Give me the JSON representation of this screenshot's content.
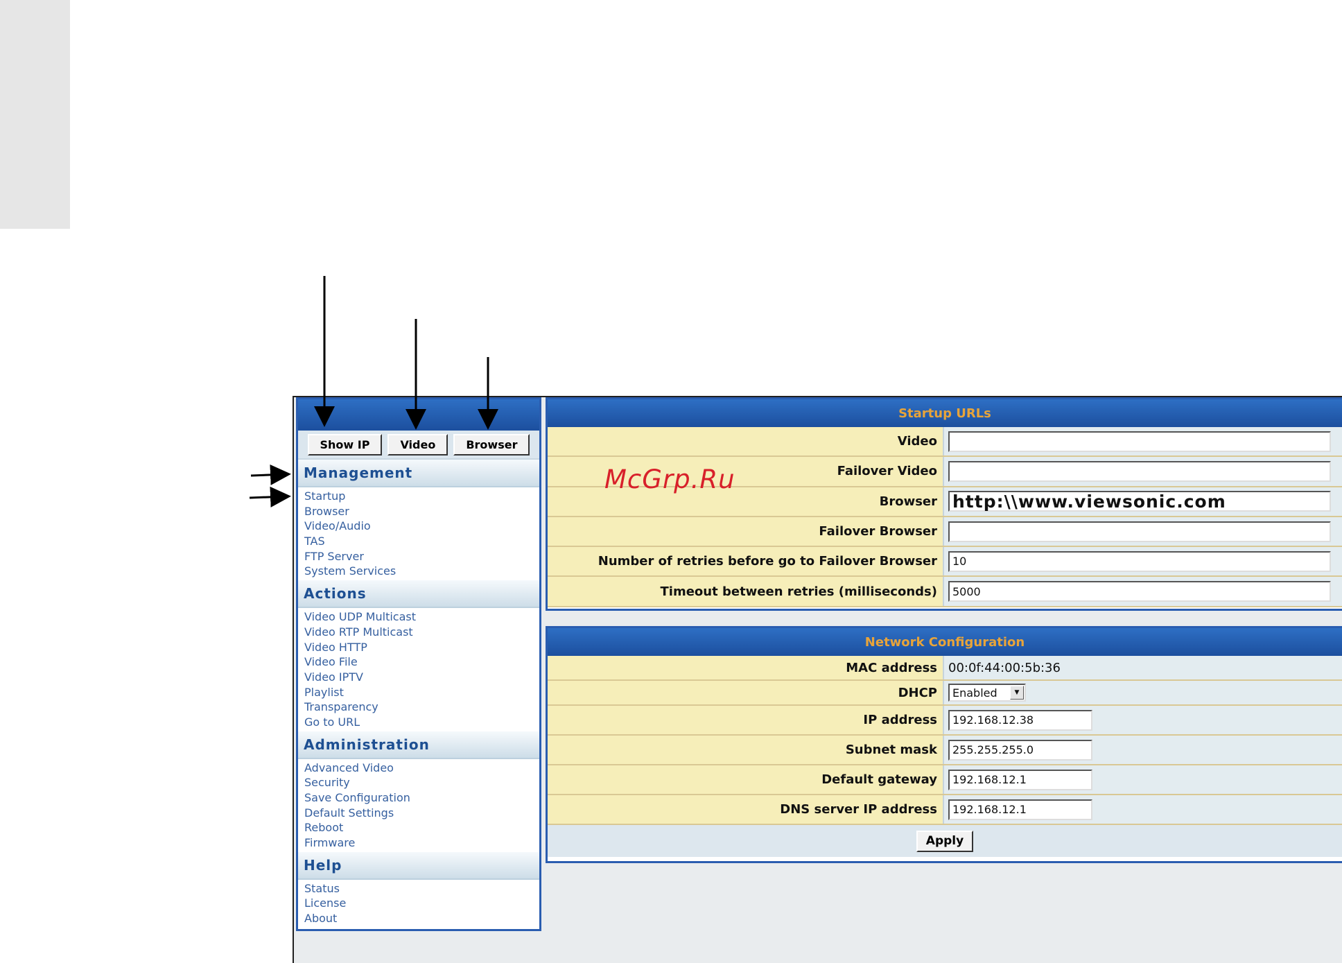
{
  "sidebar": {
    "buttons": {
      "show_ip": "Show IP",
      "video": "Video",
      "browser": "Browser"
    },
    "sections": [
      {
        "title": "Management",
        "items": [
          "Startup",
          "Browser",
          "Video/Audio",
          "TAS",
          "FTP Server",
          "System Services"
        ]
      },
      {
        "title": "Actions",
        "items": [
          "Video UDP Multicast",
          "Video RTP Multicast",
          "Video HTTP",
          "Video File",
          "Video IPTV",
          "Playlist",
          "Transparency",
          "Go to URL"
        ]
      },
      {
        "title": "Administration",
        "items": [
          "Advanced Video",
          "Security",
          "Save Configuration",
          "Default Settings",
          "Reboot",
          "Firmware"
        ]
      },
      {
        "title": "Help",
        "items": [
          "Status",
          "License",
          "About"
        ]
      }
    ]
  },
  "startup": {
    "title": "Startup URLs",
    "video_label": "Video",
    "video_value": "",
    "failover_video_label": "Failover Video",
    "failover_video_value": "",
    "browser_label": "Browser",
    "browser_value": "http:\\\\www.viewsonic.com",
    "failover_browser_label": "Failover Browser",
    "failover_browser_value": "",
    "retries_label": "Number of retries before go to Failover Browser",
    "retries_value": "10",
    "timeout_label": "Timeout between retries (milliseconds)",
    "timeout_value": "5000"
  },
  "network": {
    "title": "Network Configuration",
    "mac_label": "MAC address",
    "mac_value": "00:0f:44:00:5b:36",
    "dhcp_label": "DHCP",
    "dhcp_value": "Enabled",
    "ip_label": "IP address",
    "ip_value": "192.168.12.38",
    "subnet_label": "Subnet mask",
    "subnet_value": "255.255.255.0",
    "gateway_label": "Default gateway",
    "gateway_value": "192.168.12.1",
    "dns_label": "DNS server IP address",
    "dns_value": "192.168.12.1",
    "apply_label": "Apply"
  },
  "watermark": "McGrp.Ru",
  "colors": {
    "header_blue": "#1c4f9e",
    "header_text": "#e8a43a",
    "label_bg": "#f6eeb9",
    "link": "#355f9f"
  }
}
